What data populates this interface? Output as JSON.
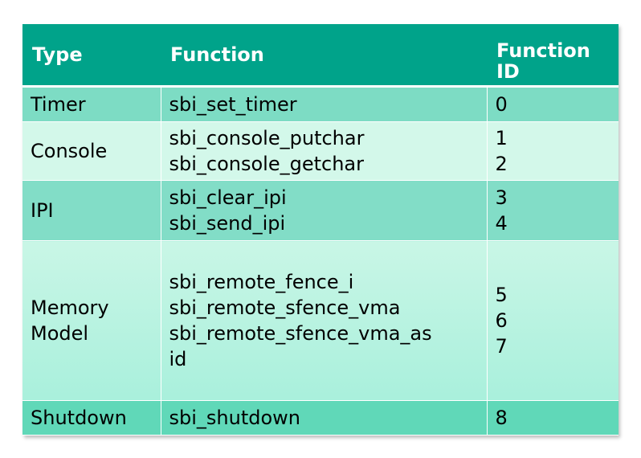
{
  "headers": {
    "type": "Type",
    "function": "Function",
    "function_id_line1": "Function",
    "function_id_line2": "ID"
  },
  "rows": [
    {
      "type": [
        "Timer"
      ],
      "functions": [
        "sbi_set_timer"
      ],
      "ids": [
        "0"
      ]
    },
    {
      "type": [
        "Console"
      ],
      "functions": [
        "sbi_console_putchar",
        "sbi_console_getchar"
      ],
      "ids": [
        "1",
        "2"
      ]
    },
    {
      "type": [
        "IPI"
      ],
      "functions": [
        "sbi_clear_ipi",
        "sbi_send_ipi"
      ],
      "ids": [
        "3",
        "4"
      ]
    },
    {
      "type": [
        "Memory",
        "Model"
      ],
      "functions": [
        "sbi_remote_fence_i",
        "sbi_remote_sfence_vma",
        "sbi_remote_sfence_vma_as",
        "id"
      ],
      "ids": [
        "5",
        "6",
        "7"
      ]
    },
    {
      "type": [
        "Shutdown"
      ],
      "functions": [
        "sbi_shutdown"
      ],
      "ids": [
        "8"
      ]
    }
  ],
  "colors": {
    "header_bg": "#00a38a",
    "header_text": "#ffffff"
  }
}
